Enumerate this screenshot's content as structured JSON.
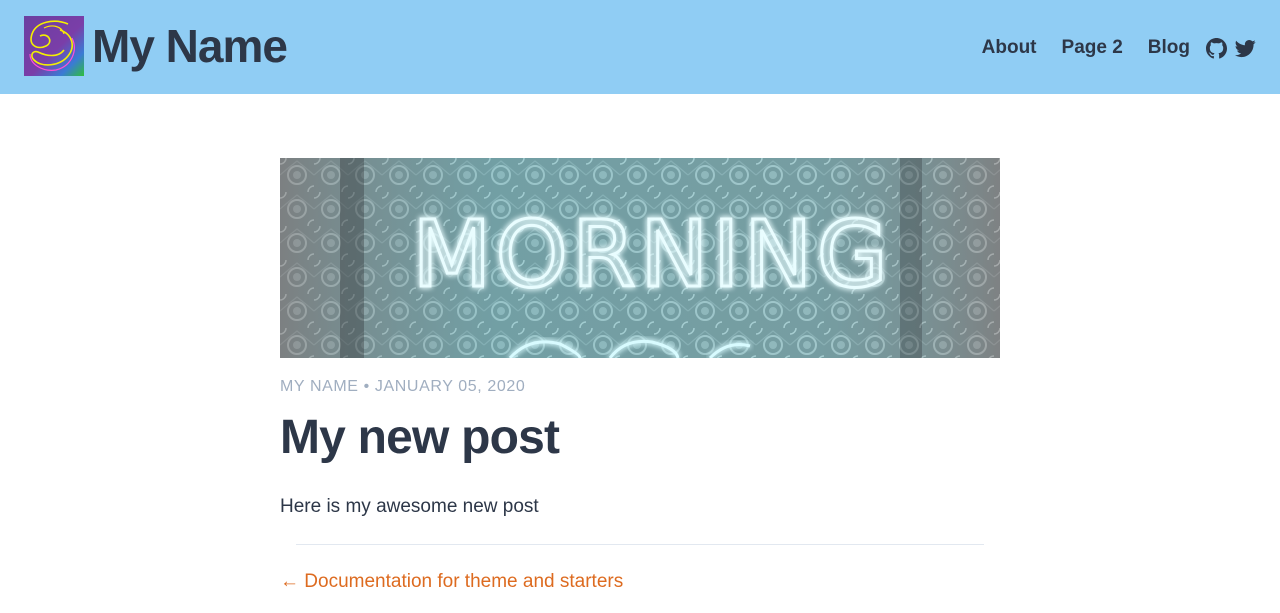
{
  "header": {
    "site_title": "My Name",
    "logo": "abstract-swirl-logo",
    "nav": [
      {
        "label": "About"
      },
      {
        "label": "Page 2"
      },
      {
        "label": "Blog"
      }
    ],
    "social_icons": [
      "github-icon",
      "twitter-icon"
    ],
    "background_color": "#90cdf4"
  },
  "post": {
    "hero_image": "neon-sign-morning-glory",
    "hero_text": "MORNING",
    "author": "MY NAME",
    "date": "JANUARY 05, 2020",
    "separator": "•",
    "title": "My new post",
    "body": "Here is my awesome new post"
  },
  "footer_nav": {
    "prev_arrow": "←",
    "prev_label": "Documentation for theme and starters",
    "link_color": "#dd6b20"
  }
}
